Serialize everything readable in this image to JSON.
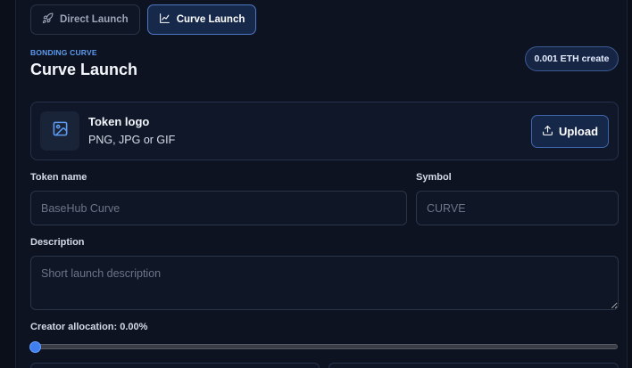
{
  "tabs": [
    {
      "label": "Direct Launch",
      "icon": "rocket-icon",
      "active": false
    },
    {
      "label": "Curve Launch",
      "icon": "line-chart-icon",
      "active": true
    }
  ],
  "header": {
    "overline": "BONDING CURVE",
    "title": "Curve Launch",
    "fee_badge": "0.001 ETH create"
  },
  "logo_upload": {
    "title": "Token logo",
    "subtitle": "PNG, JPG or GIF",
    "icon": "image-icon",
    "button_label": "Upload",
    "button_icon": "upload-icon"
  },
  "form": {
    "token_name": {
      "label": "Token name",
      "placeholder": "BaseHub Curve",
      "value": ""
    },
    "symbol": {
      "label": "Symbol",
      "placeholder": "CURVE",
      "value": ""
    },
    "description": {
      "label": "Description",
      "placeholder": "Short launch description",
      "value": ""
    },
    "creator_allocation": {
      "label": "Creator allocation: 0.00%",
      "value_percent": 0
    }
  },
  "colors": {
    "accent": "#3f7ff0",
    "background": "#0d1321",
    "active_tab_bg": "#16294b",
    "overline": "#5d9bf0"
  }
}
